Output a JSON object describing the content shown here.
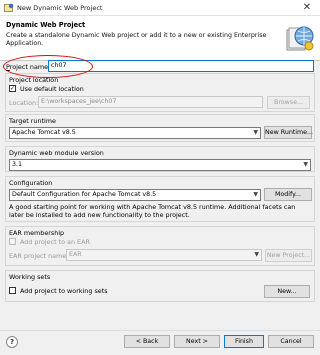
{
  "window": {
    "title": "New Dynamic Web Project",
    "close_glyph": "✕",
    "app_icon": "eclipse-new-project-icon"
  },
  "header": {
    "title": "Dynamic Web Project",
    "description": "Create a standalone Dynamic Web project or add it to a new or existing Enterprise Application.",
    "icon": "web-project-wizard-icon"
  },
  "project_name": {
    "label": "Project name:",
    "value": "ch07"
  },
  "project_location": {
    "title": "Project location",
    "use_default_label": "Use default location",
    "use_default_checked": true,
    "location_label": "Location:",
    "location_value": "E:\\workspaces_jee\\ch07",
    "browse_label": "Browse..."
  },
  "target_runtime": {
    "title": "Target runtime",
    "selected": "Apache Tomcat v8.5",
    "new_runtime_label": "New Runtime..."
  },
  "module_version": {
    "title": "Dynamic web module version",
    "selected": "3.1"
  },
  "configuration": {
    "title": "Configuration",
    "selected": "Default Configuration for Apache Tomcat v8.5",
    "modify_label": "Modify...",
    "description": "A good starting point for working with Apache Tomcat v8.5 runtime. Additional facets can later be installed to add new functionality to the project."
  },
  "ear_membership": {
    "title": "EAR membership",
    "add_to_ear_label": "Add project to an EAR",
    "add_to_ear_checked": false,
    "ear_name_label": "EAR project name:",
    "ear_name_value": "EAR",
    "new_project_label": "New Project..."
  },
  "working_sets": {
    "title": "Working sets",
    "add_label": "Add project to working sets",
    "add_checked": false,
    "new_label": "New..."
  },
  "footer": {
    "help_glyph": "?",
    "back_label": "< Back",
    "next_label": "Next >",
    "finish_label": "Finish",
    "cancel_label": "Cancel"
  },
  "colors": {
    "annotation_red": "#d01010",
    "header_bg": "#ffffff",
    "dialog_bg": "#f0f0f0"
  }
}
